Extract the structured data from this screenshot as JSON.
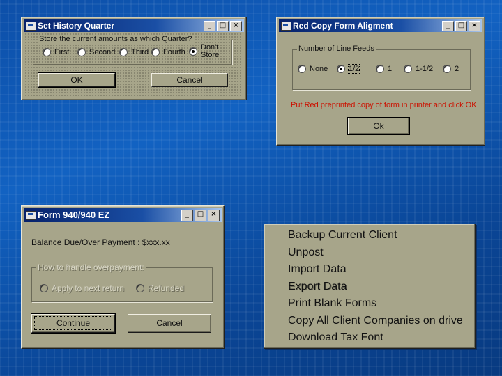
{
  "win1": {
    "title": "Set History Quarter",
    "question": "Store the current amounts as which Quarter?",
    "options": [
      "First",
      "Second",
      "Third",
      "Fourth",
      "Don't\nStore"
    ],
    "selected_index": 4,
    "ok_label": "OK",
    "cancel_label": "Cancel"
  },
  "win2": {
    "title": "Red Copy Form Aligment",
    "group_label": "Number of Line Feeds",
    "options": [
      "None",
      "1/2",
      "1",
      "1-1/2",
      "2"
    ],
    "selected_index": 1,
    "instruction": "Put Red preprinted copy of form in printer and click OK",
    "ok_label": "Ok",
    "instruction_color": "#cc1100"
  },
  "win3": {
    "title": "Form 940/940 EZ",
    "balance_text": "Balance Due/Over Payment : $xxx.xx",
    "group_label": "How to handle overpayment:",
    "options": [
      "Apply to next return",
      "Refunded"
    ],
    "continue_label": "Continue",
    "cancel_label": "Cancel"
  },
  "menu": {
    "items": [
      {
        "label": "Backup Current Client",
        "enabled": true
      },
      {
        "label": "Unpost",
        "enabled": true
      },
      {
        "label": "Import Data",
        "enabled": true
      },
      {
        "label": "Export Data",
        "enabled": false
      },
      {
        "label": "Print Blank Forms",
        "enabled": true
      },
      {
        "label": "Copy All Client Companies on drive",
        "enabled": true
      },
      {
        "label": "Download Tax Font",
        "enabled": true
      }
    ]
  },
  "title_buttons": {
    "minimize": "_",
    "maximize": "□",
    "close": "×"
  },
  "colors": {
    "window_face": "#a7a58a",
    "titlebar_start": "#07216a",
    "desktop": "#1262c2"
  }
}
